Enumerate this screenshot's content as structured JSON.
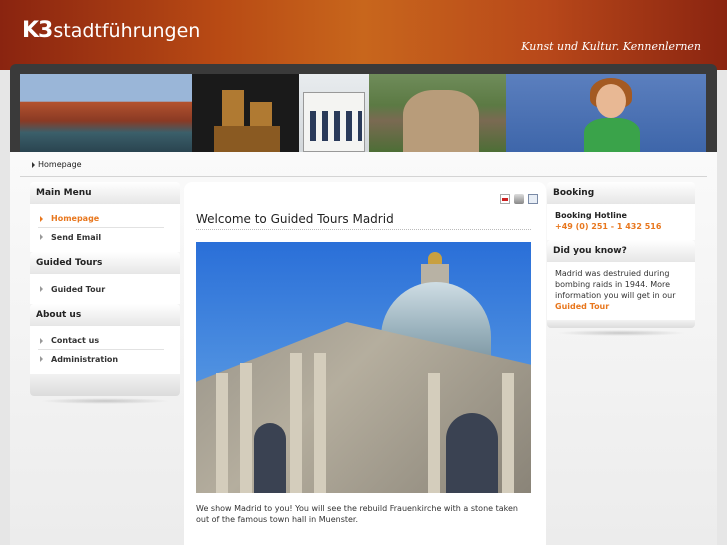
{
  "header": {
    "logo_mark": "K3",
    "logo_text": "stadtführungen",
    "tagline": "Kunst und Kultur. Kennenlernen"
  },
  "breadcrumb": {
    "current": "Homepage"
  },
  "main_menu": {
    "title": "Main Menu",
    "items": [
      {
        "label": "Homepage",
        "active": true
      },
      {
        "label": "Send Email",
        "active": false
      }
    ]
  },
  "guided_tours_menu": {
    "title": "Guided Tours",
    "items": [
      {
        "label": "Guided Tour"
      }
    ]
  },
  "about_menu": {
    "title": "About us",
    "items": [
      {
        "label": "Contact us"
      },
      {
        "label": "Administration"
      }
    ]
  },
  "content": {
    "title": "Welcome to Guided Tours Madrid",
    "caption": "We show Madrid to you! You will see the rebuild Frauenkirche with a stone taken out of the famous town hall in Muenster.",
    "tools": [
      "pdf-icon",
      "print-icon",
      "email-icon"
    ]
  },
  "booking": {
    "title": "Booking",
    "hotline_label": "Booking Hotline",
    "hotline_number": "+49 (0) 251 - 1 432 516"
  },
  "did_you_know": {
    "title": "Did you know?",
    "text": "Madrid was destruied during bombing raids in 1944. More information you will get in our",
    "link": "Guided Tour"
  },
  "colors": {
    "accent": "#e8771e",
    "header_dark": "#8a2410",
    "header_light": "#c8661c"
  }
}
